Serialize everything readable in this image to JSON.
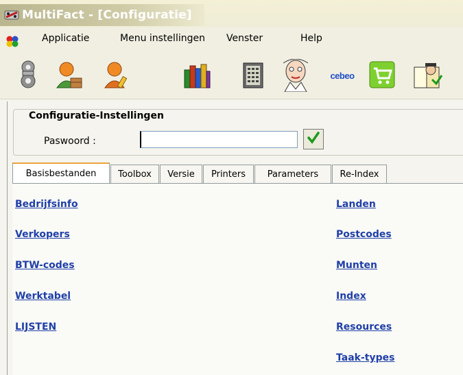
{
  "window": {
    "title": "MultiFact - [Configuratie]"
  },
  "menu": {
    "items": [
      "Applicatie",
      "Menu instellingen",
      "Venster",
      "Help"
    ]
  },
  "toolbar": {
    "icons": [
      "settings-bolts-icon",
      "user-package-icon",
      "user-edit-icon",
      "books-icon",
      "calculator-notebook-icon",
      "person-face-icon",
      "cebeo-logo-icon",
      "shopping-cart-icon",
      "reader-book-icon"
    ],
    "cebeo_label": "cebeo"
  },
  "config": {
    "group_label": "Configuratie-Instellingen",
    "password_label": "Paswoord :",
    "password_value": "",
    "confirm_icon": "checkmark-icon"
  },
  "tabs": [
    "Basisbestanden",
    "Toolbox",
    "Versie",
    "Printers",
    "Parameters",
    "Re-Index"
  ],
  "active_tab": "Basisbestanden",
  "links_left": [
    "Bedrijfsinfo",
    "Verkopers",
    "BTW-codes",
    "Werktabel",
    "LIJSTEN"
  ],
  "links_right": [
    "Landen",
    "Postcodes",
    "Munten",
    "Index",
    "Resources",
    "Taak-types"
  ],
  "colors": {
    "link": "#1f3fa8",
    "title_text": "#ffffff",
    "tab_accent": "#e8a33b",
    "check_green": "#1a9a1a"
  }
}
